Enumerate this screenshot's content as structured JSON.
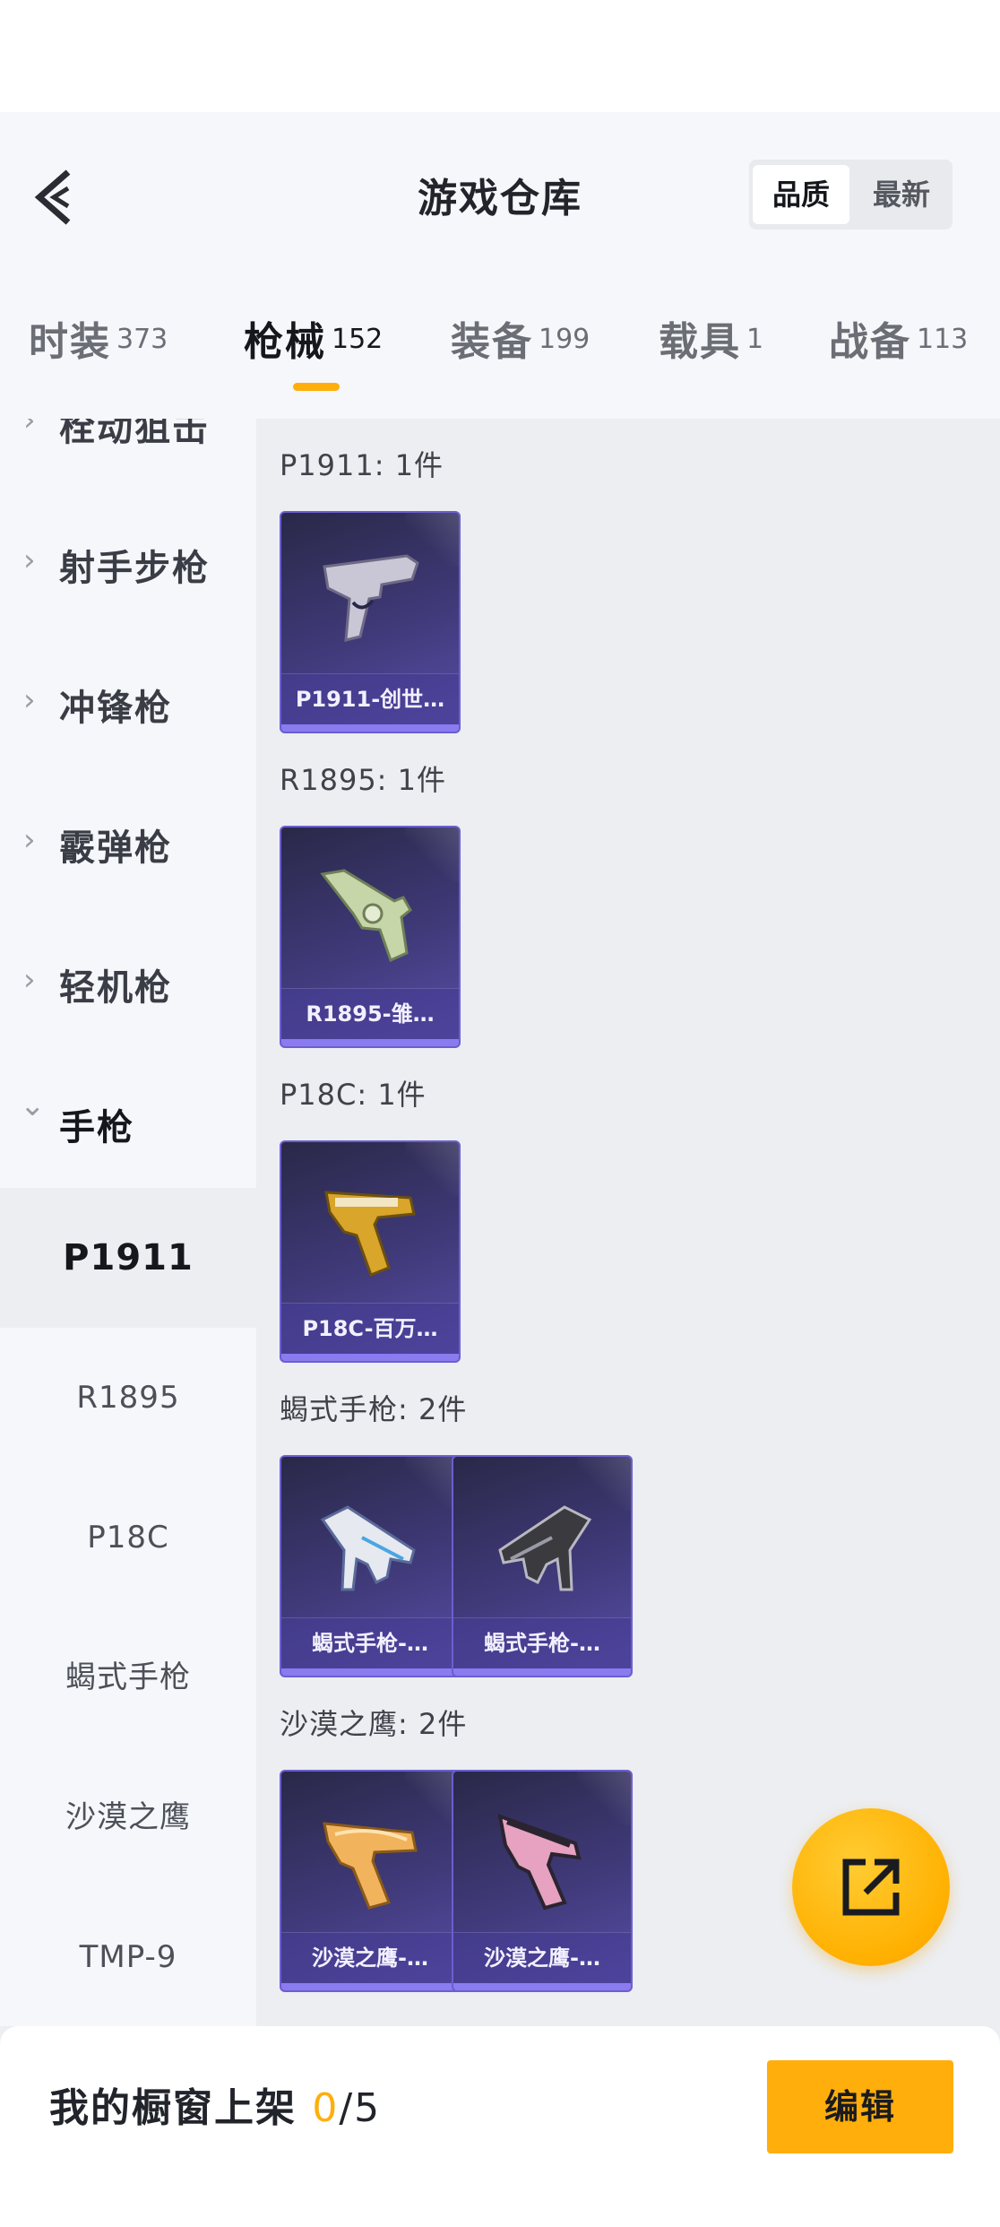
{
  "header": {
    "title": "游戏仓库",
    "sort_options": [
      {
        "label": "品质",
        "active": true
      },
      {
        "label": "最新",
        "active": false
      }
    ]
  },
  "tabs": [
    {
      "label": "时装",
      "count": "373"
    },
    {
      "label": "枪械",
      "count": "152",
      "active": true
    },
    {
      "label": "装备",
      "count": "199"
    },
    {
      "label": "载具",
      "count": "1"
    },
    {
      "label": "战备",
      "count": "113"
    }
  ],
  "sidebar": {
    "categories": [
      {
        "label": "栓动狙击",
        "chevron": "›"
      },
      {
        "label": "射手步枪",
        "chevron": "›"
      },
      {
        "label": "冲锋枪",
        "chevron": "›"
      },
      {
        "label": "霰弹枪",
        "chevron": "›"
      },
      {
        "label": "轻机枪",
        "chevron": "›"
      },
      {
        "label": "手枪",
        "chevron": "⌄"
      }
    ],
    "subitems": [
      {
        "label": "P1911",
        "active": true
      },
      {
        "label": "R1895"
      },
      {
        "label": "P18C"
      },
      {
        "label": "蝎式手枪"
      },
      {
        "label": "沙漠之鹰"
      },
      {
        "label": "TMP-9"
      }
    ]
  },
  "groups": [
    {
      "title": "P1911: 1件",
      "items": [
        {
          "name": "P1911-创世…",
          "icon": "pistol-silver-icon",
          "color": "#c9c6d6"
        }
      ]
    },
    {
      "title": "R1895: 1件",
      "items": [
        {
          "name": "R1895-雏…",
          "icon": "revolver-green-icon",
          "color": "#c7d6a8"
        }
      ]
    },
    {
      "title": "P18C: 1件",
      "items": [
        {
          "name": "P18C-百万…",
          "icon": "pistol-gold-icon",
          "color": "#d9a52a"
        }
      ]
    },
    {
      "title": "蝎式手枪: 2件",
      "items": [
        {
          "name": "蝎式手枪-…",
          "icon": "smg-white-icon",
          "color": "#e6e9f0"
        },
        {
          "name": "蝎式手枪-…",
          "icon": "smg-black-icon",
          "color": "#3a3a3f"
        }
      ]
    },
    {
      "title": "沙漠之鹰: 2件",
      "items": [
        {
          "name": "沙漠之鹰-…",
          "icon": "deagle-orange-icon",
          "color": "#f1b45c"
        },
        {
          "name": "沙漠之鹰-…",
          "icon": "deagle-pink-icon",
          "color": "#e6a2c0"
        }
      ]
    }
  ],
  "footer": {
    "label": "我的橱窗上架",
    "current": "0",
    "total": "/5",
    "edit_label": "编辑"
  },
  "colors": {
    "accent": "#ffae0c",
    "card_bg": "#403a7a",
    "card_border": "#6b5fd0"
  }
}
